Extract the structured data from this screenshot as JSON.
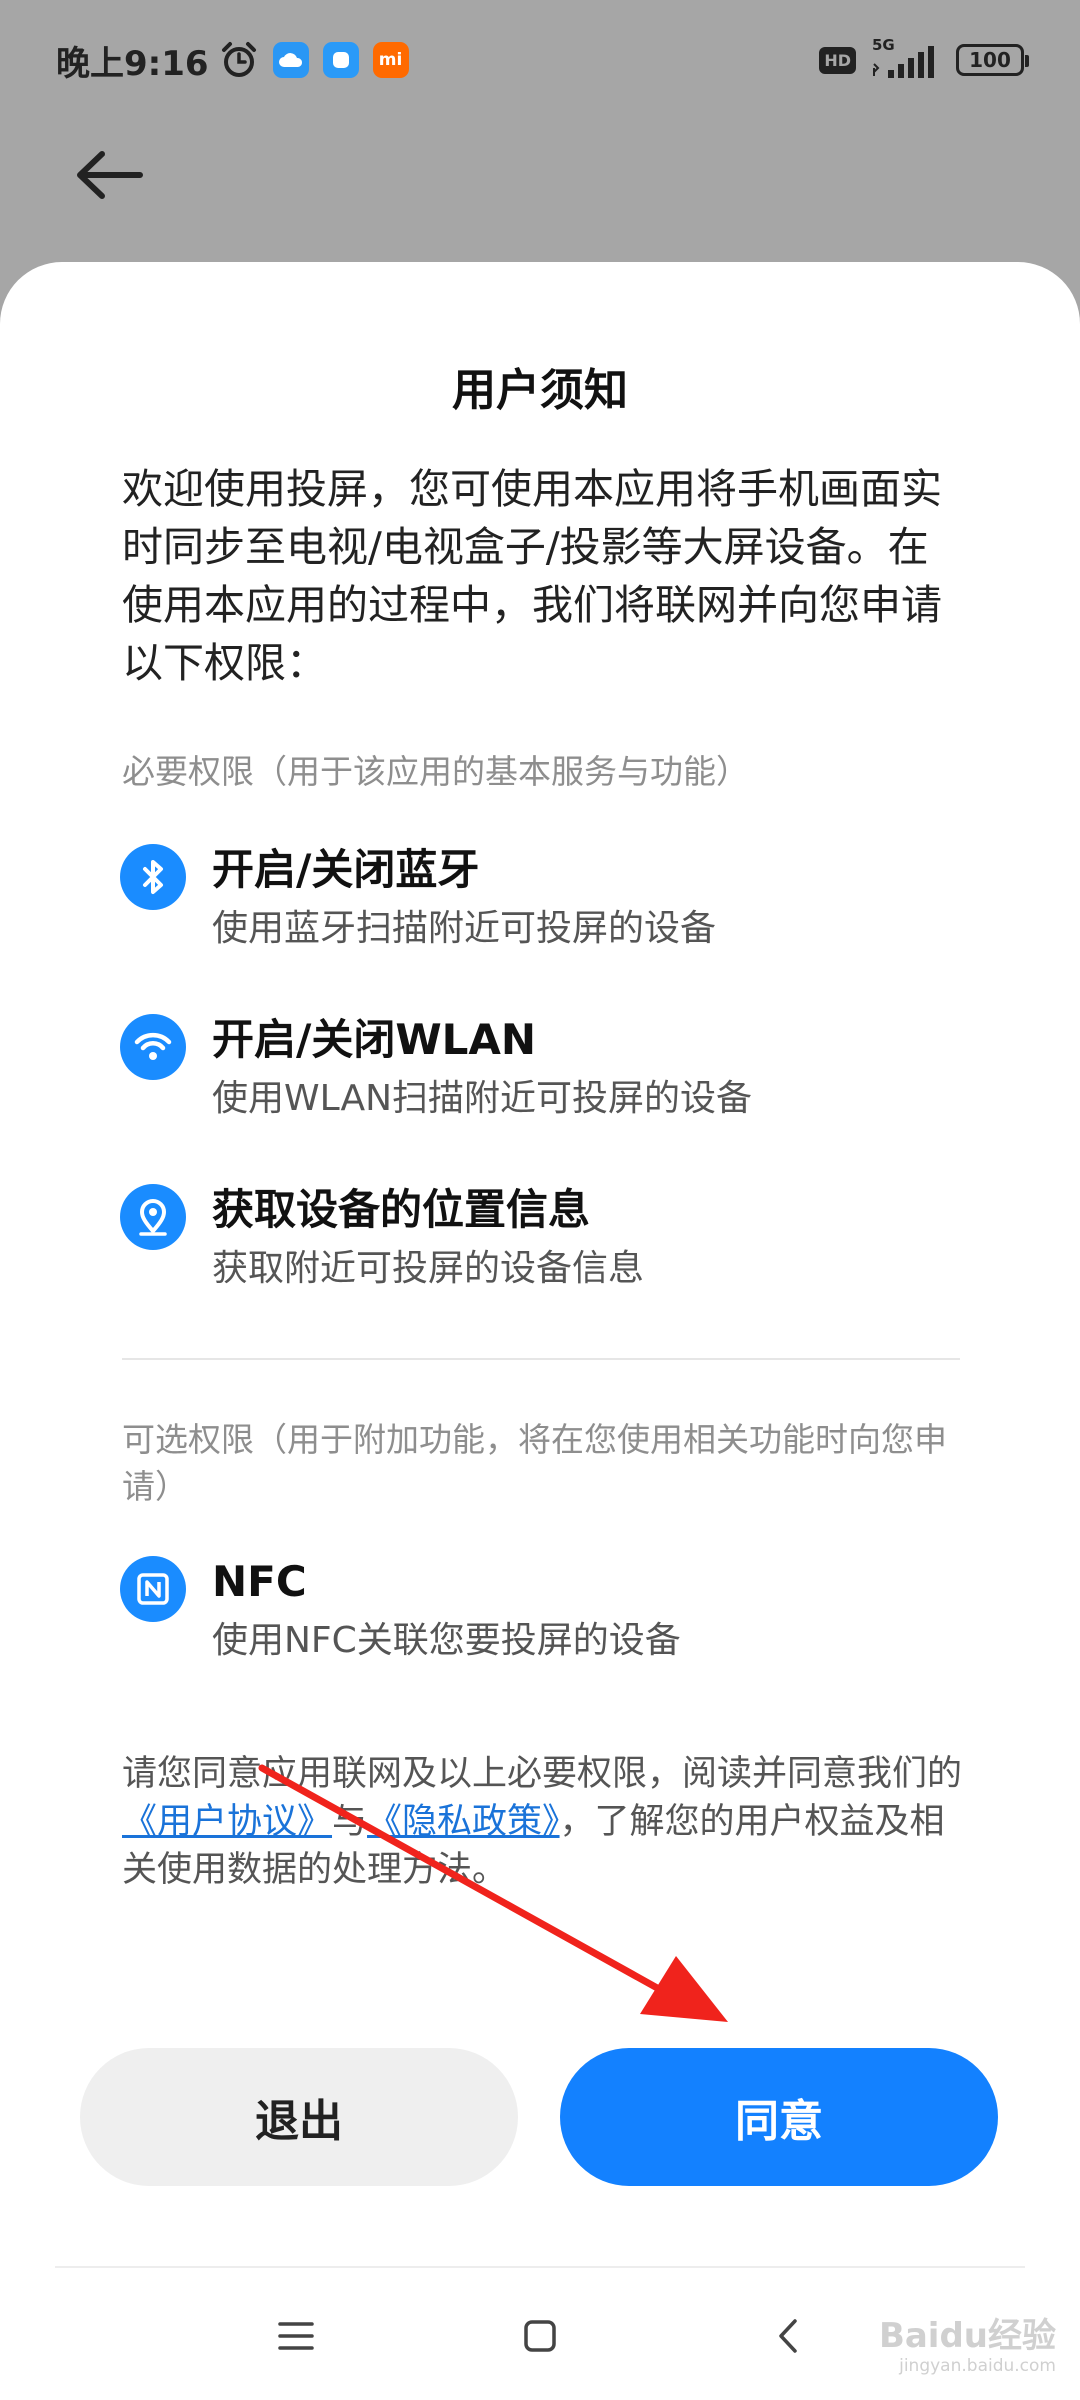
{
  "status_bar": {
    "time": "晚上9:16",
    "hd": "HD",
    "network": "5G",
    "battery": "100",
    "app_icon_mi": "mi"
  },
  "sheet": {
    "title": "用户须知",
    "intro": "欢迎使用投屏，您可使用本应用将手机画面实时同步至电视/电视盒子/投影等大屏设备。在使用本应用的过程中，我们将联网并向您申请以下权限：",
    "required_label": "必要权限（用于该应用的基本服务与功能）",
    "required": [
      {
        "icon": "bluetooth-icon",
        "title": "开启/关闭蓝牙",
        "desc": "使用蓝牙扫描附近可投屏的设备"
      },
      {
        "icon": "wifi-icon",
        "title": "开启/关闭WLAN",
        "desc": "使用WLAN扫描附近可投屏的设备"
      },
      {
        "icon": "location-icon",
        "title": "获取设备的位置信息",
        "desc": "获取附近可投屏的设备信息"
      }
    ],
    "optional_label": "可选权限（用于附加功能，将在您使用相关功能时向您申请）",
    "optional": [
      {
        "icon": "nfc-icon",
        "title": "NFC",
        "desc": "使用NFC关联您要投屏的设备"
      }
    ],
    "notice_prefix": "请您同意应用联网及以上必要权限，阅读并同意我们的",
    "user_agreement": "《用户协议》",
    "notice_and": "与",
    "privacy_policy": "《隐私政策》",
    "notice_suffix": "，了解您的用户权益及相关使用数据的处理方法。",
    "exit_label": "退出",
    "agree_label": "同意"
  },
  "colors": {
    "accent": "#1381ff",
    "icon_blue": "#1a8cff",
    "annotation_red": "#f0231c"
  },
  "watermark": {
    "brand": "Baidu经验",
    "url": "jingyan.baidu.com"
  }
}
